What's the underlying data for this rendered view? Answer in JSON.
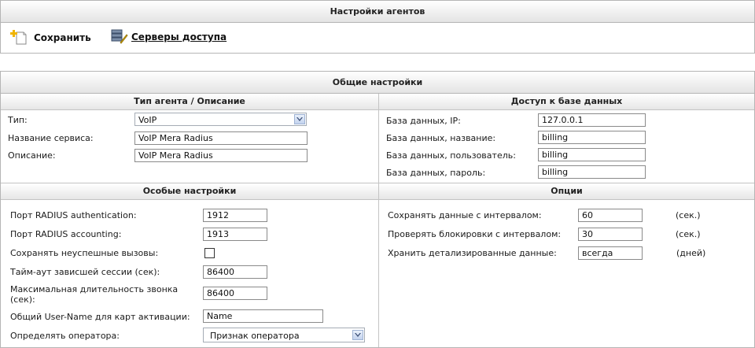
{
  "top": {
    "title": "Настройки агентов",
    "save_label": "Сохранить",
    "servers_label": "Серверы доступа"
  },
  "general": {
    "title": "Общие настройки",
    "agent": {
      "title": "Тип агента / Описание",
      "type_label": "Тип:",
      "type_value": "VoIP",
      "service_label": "Название сервиса:",
      "service_value": "VoIP Mera Radius",
      "desc_label": "Описание:",
      "desc_value": "VoIP Mera Radius"
    },
    "db": {
      "title": "Доступ к базе данных",
      "ip_label": "База данных, IP:",
      "ip_value": "127.0.0.1",
      "name_label": "База данных, название:",
      "name_value": "billing",
      "user_label": "База данных, пользователь:",
      "user_value": "billing",
      "pass_label": "База данных, пароль:",
      "pass_value": "billing"
    },
    "special": {
      "title": "Особые настройки",
      "auth_port_label": "Порт RADIUS authentication:",
      "auth_port_value": "1912",
      "acct_port_label": "Порт RADIUS accounting:",
      "acct_port_value": "1913",
      "save_failed_label": "Сохранять неуспешные вызовы:",
      "save_failed_checked": false,
      "timeout_label": "Тайм-аут зависшей сессии (сек):",
      "timeout_value": "86400",
      "maxdur_label_1": "Максимальная длительность звонка",
      "maxdur_label_2": "(сек):",
      "maxdur_value": "86400",
      "username_label": "Общий User-Name для карт активации:",
      "username_value": "Name",
      "operator_label": "Определять оператора:",
      "operator_value": "Признак оператора"
    },
    "options": {
      "title": "Опции",
      "save_int_label": "Сохранять данные с интервалом:",
      "save_int_value": "60",
      "save_int_unit": "(сек.)",
      "check_label": "Проверять блокировки с интервалом:",
      "check_value": "30",
      "check_unit": "(сек.)",
      "keep_label": "Хранить детализированные данные:",
      "keep_value": "всегда",
      "keep_unit": "(дней)"
    }
  }
}
